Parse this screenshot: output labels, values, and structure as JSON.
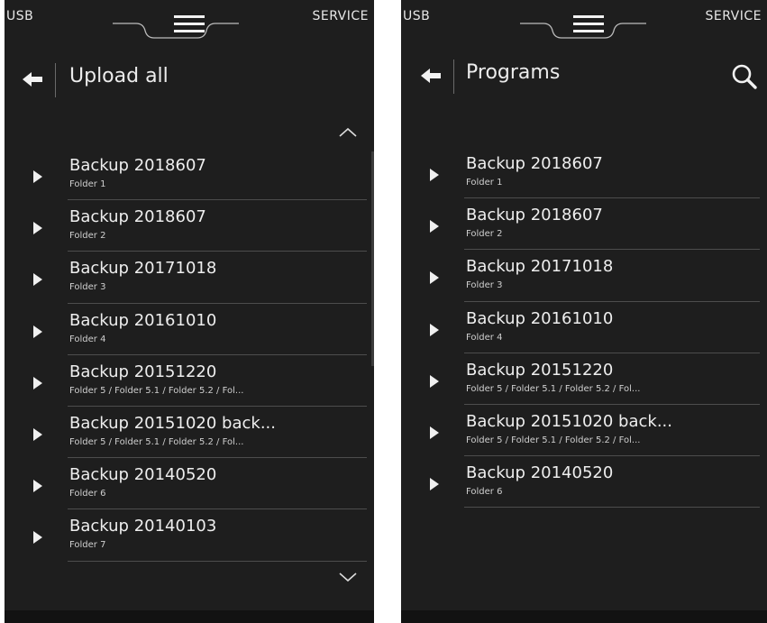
{
  "colors": {
    "background": "#1e1e1e",
    "text": "#eeeeee",
    "divider": "#4d4d4d"
  },
  "top_bar": {
    "left_label": "USB",
    "right_label": "SERVICE",
    "menu_icon": "hamburger-menu-icon"
  },
  "left_panel": {
    "title": "Upload all",
    "back_icon": "arrow-left-icon",
    "scroll_up_icon": "chevron-up-icon",
    "scroll_down_icon": "chevron-down-icon",
    "items": [
      {
        "title": "Backup 2018607",
        "path": "Folder 1"
      },
      {
        "title": "Backup 2018607",
        "path": "Folder 2"
      },
      {
        "title": "Backup 20171018",
        "path": "Folder 3"
      },
      {
        "title": "Backup 20161010",
        "path": "Folder 4"
      },
      {
        "title": "Backup 20151220",
        "path": "Folder 5 / Folder 5.1 / Folder 5.2 / Fol..."
      },
      {
        "title": "Backup 20151020 back...",
        "path": "Folder 5 / Folder 5.1 / Folder 5.2 / Fol..."
      },
      {
        "title": "Backup 20140520",
        "path": "Folder 6"
      },
      {
        "title": "Backup 20140103",
        "path": "Folder 7"
      }
    ]
  },
  "right_panel": {
    "title": "Programs",
    "back_icon": "arrow-left-icon",
    "search_icon": "search-icon",
    "items": [
      {
        "title": "Backup 2018607",
        "path": "Folder 1"
      },
      {
        "title": "Backup 2018607",
        "path": "Folder 2"
      },
      {
        "title": "Backup 20171018",
        "path": "Folder 3"
      },
      {
        "title": "Backup 20161010",
        "path": "Folder 4"
      },
      {
        "title": "Backup 20151220",
        "path": "Folder 5 / Folder 5.1 / Folder 5.2 / Fol..."
      },
      {
        "title": "Backup 20151020 back...",
        "path": "Folder 5 / Folder 5.1 / Folder 5.2 / Fol..."
      },
      {
        "title": "Backup 20140520",
        "path": "Folder 6"
      }
    ]
  }
}
